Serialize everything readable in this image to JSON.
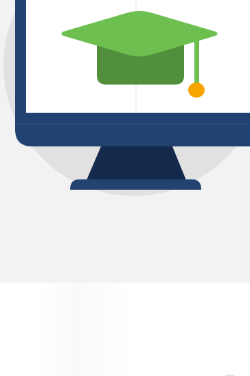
{
  "illustration": {
    "subject": "computer-monitor-with-graduation-cap",
    "icons": [
      "monitor-icon",
      "graduation-cap-icon"
    ],
    "colors": {
      "panel_background": "#f2f2f2",
      "backdrop_circle": "#e1e1e1",
      "monitor_frame": "#224272",
      "monitor_stand": "#15294d",
      "screen": "#ffffff",
      "cap_top": "#6dbf4f",
      "cap_body": "#528f3c",
      "tassel_cord": "#6dbf4f",
      "tassel_knot": "#f7a400"
    }
  }
}
